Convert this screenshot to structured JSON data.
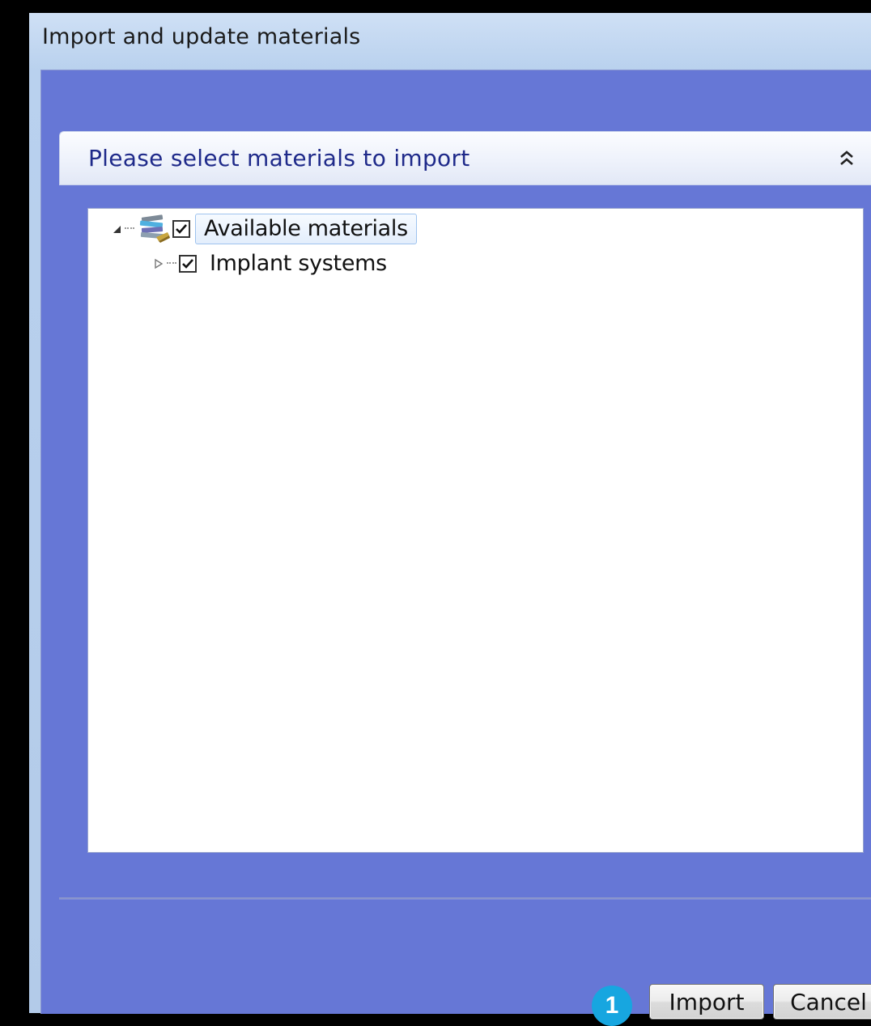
{
  "window": {
    "title": "Import and update materials"
  },
  "group": {
    "title": "Please select materials to import",
    "collapse_icon": "double-chevron-up-icon"
  },
  "tree": {
    "nodes": [
      {
        "label": "Available materials",
        "checked": true,
        "expanded": true,
        "icon": "books-icon",
        "selected": true
      },
      {
        "label": "Implant systems",
        "checked": true,
        "expanded": false
      }
    ]
  },
  "annotation": {
    "badge": "1",
    "color": "#17a6e0"
  },
  "buttons": {
    "import_label": "Import",
    "cancel_label": "Cancel"
  },
  "colors": {
    "client_background": "#6677d6",
    "group_title": "#1f2a8a"
  }
}
